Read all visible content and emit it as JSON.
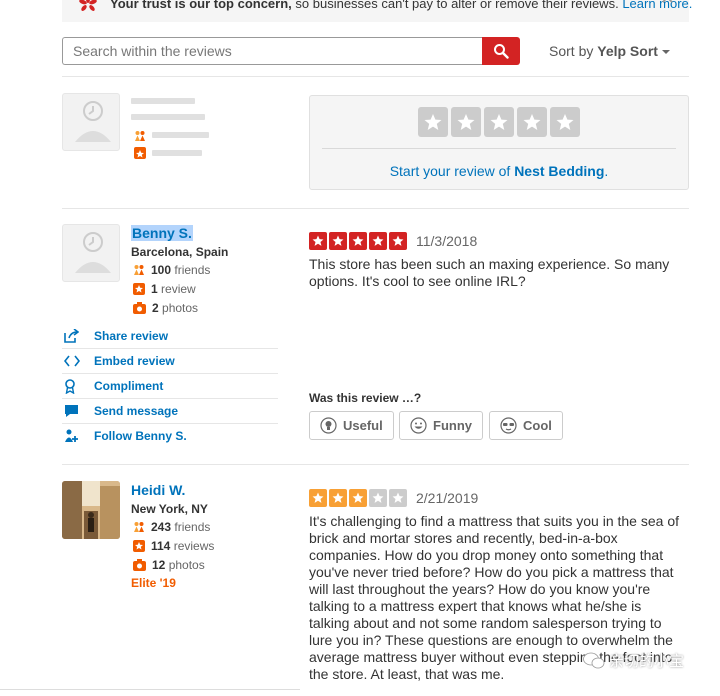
{
  "banner": {
    "bold": "Your trust is our top concern,",
    "text": " so businesses can't pay to alter or remove their reviews. ",
    "link": "Learn more."
  },
  "search": {
    "placeholder": "Search within the reviews"
  },
  "sort": {
    "prefix": "Sort by ",
    "value": "Yelp Sort"
  },
  "write_review": {
    "prefix": "Start your review of ",
    "business": "Nest Bedding",
    "suffix": "."
  },
  "vote_prompt": "Was this review …?",
  "votes": [
    "Useful",
    "Funny",
    "Cool"
  ],
  "reviews": [
    {
      "name": "Benny S.",
      "location": "Barcelona, Spain",
      "friends": "100",
      "friends_label": " friends",
      "reviews": "1",
      "reviews_label": " review",
      "photos": "2",
      "photos_label": " photos",
      "rating": 5,
      "date": "11/3/2018",
      "text": "This store has been such an maxing experience. So many options. It's cool to see online IRL?",
      "actions": [
        "Share review",
        "Embed review",
        "Compliment",
        "Send message",
        "Follow Benny S."
      ]
    },
    {
      "name": "Heidi W.",
      "location": "New York, NY",
      "friends": "243",
      "friends_label": " friends",
      "reviews": "114",
      "reviews_label": " reviews",
      "photos": "12",
      "photos_label": " photos",
      "elite": "Elite '19",
      "rating": 3,
      "date": "2/21/2019",
      "text": "It's challenging to find a mattress that suits you in the sea of brick and mortar stores and recently, bed-in-a-box companies. How do you drop money onto something that you've never tried before? How do you pick a mattress that will last throughout the years? How do you know you're talking to a mattress expert that knows what he/she is talking about and not some random salesperson trying to lure you in? These questions are enough to overwhelm the average mattress buyer without even stepping the foot into the store. At least, that was me."
    }
  ],
  "watermark": "亲切的小宝",
  "colors": {
    "yelp_red": "#d32323",
    "link_blue": "#0073bb",
    "star_red": "#d32323",
    "star_orange": "#f8a035",
    "star_gray": "#ccc"
  }
}
